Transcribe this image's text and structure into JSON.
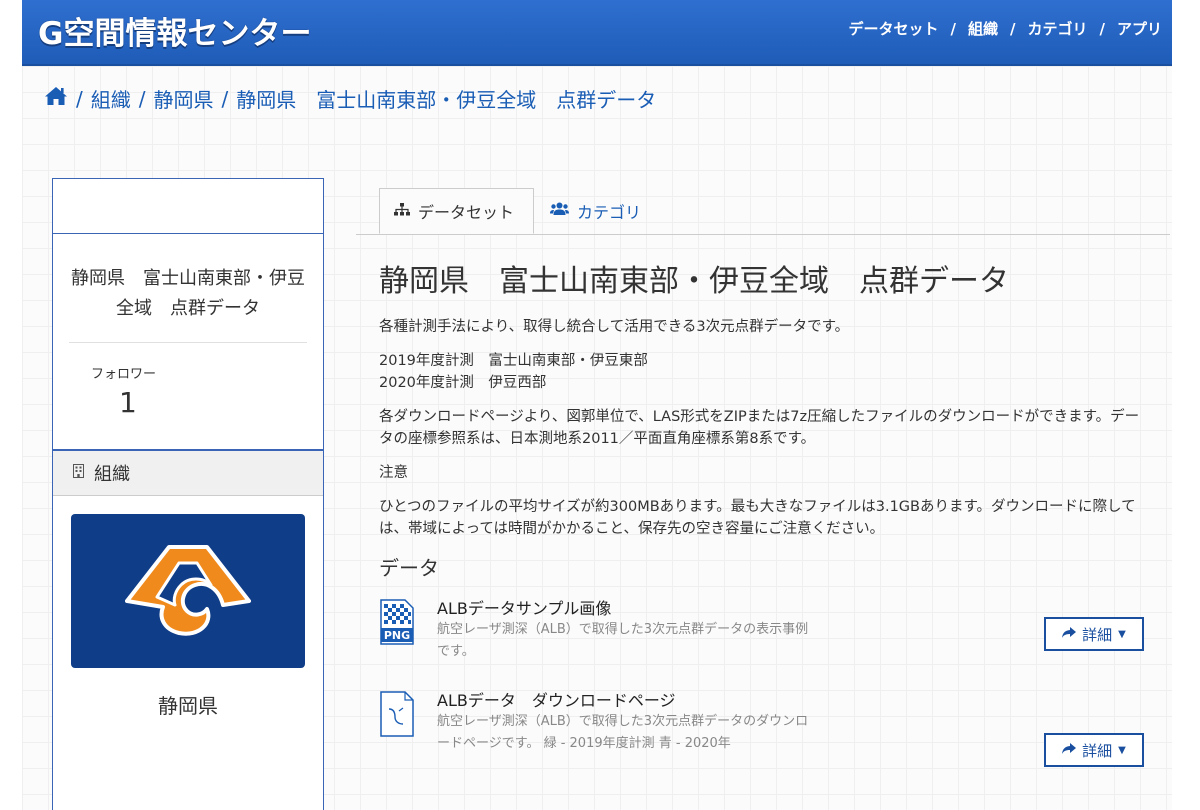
{
  "header": {
    "site_title": "G空間情報センター",
    "nav": [
      "データセット",
      "組織",
      "カテゴリ",
      "アプリ"
    ]
  },
  "breadcrumb": {
    "home_icon": "home-icon",
    "items": [
      "組織",
      "静岡県",
      "静岡県　富士山南東部・伊豆全域　点群データ"
    ]
  },
  "sidebar": {
    "dataset_title": "静岡県　富士山南東部・伊豆全域　点群データ",
    "followers_label": "フォロワー",
    "followers_count": "1",
    "org_section_label": "組織",
    "org_name": "静岡県"
  },
  "tabs": [
    {
      "label": "データセット",
      "icon": "sitemap-icon",
      "active": true
    },
    {
      "label": "カテゴリ",
      "icon": "users-icon",
      "active": false
    }
  ],
  "main": {
    "title": "静岡県　富士山南東部・伊豆全域　点群データ",
    "p1": "各種計測手法により、取得し統合して活用できる3次元点群データです。",
    "p2_line1": "2019年度計測　富士山南東部・伊豆東部",
    "p2_line2": "2020年度計測　伊豆西部",
    "p3": "各ダウンロードページより、図郭単位で、LAS形式をZIPまたは7z圧縮したファイルのダウンロードができます。データの座標参照系は、日本測地系2011／平面直角座標系第8系です。",
    "p4": "注意",
    "p5": "ひとつのファイルの平均サイズが約300MBあります。最も大きなファイルは3.1GBあります。ダウンロードに際しては、帯域によっては時間がかかること、保存先の空き容量にご注意ください。",
    "data_heading": "データ",
    "resources": [
      {
        "title": "ALBデータサンプル画像",
        "desc": "航空レーザ測深（ALB）で取得した3次元点群データの表示事例です。",
        "format": "PNG",
        "button": "詳細"
      },
      {
        "title": "ALBデータ　ダウンロードページ",
        "desc": "航空レーザ測深（ALB）で取得した3次元点群データのダウンロードページです。 緑 - 2019年度計測 青 - 2020年",
        "format": "",
        "button": "詳細"
      }
    ]
  },
  "colors": {
    "header_blue": "#1f5cb8",
    "link_blue": "#1a5db5",
    "org_logo_bg": "#103d87",
    "logo_orange": "#f08a1c"
  }
}
